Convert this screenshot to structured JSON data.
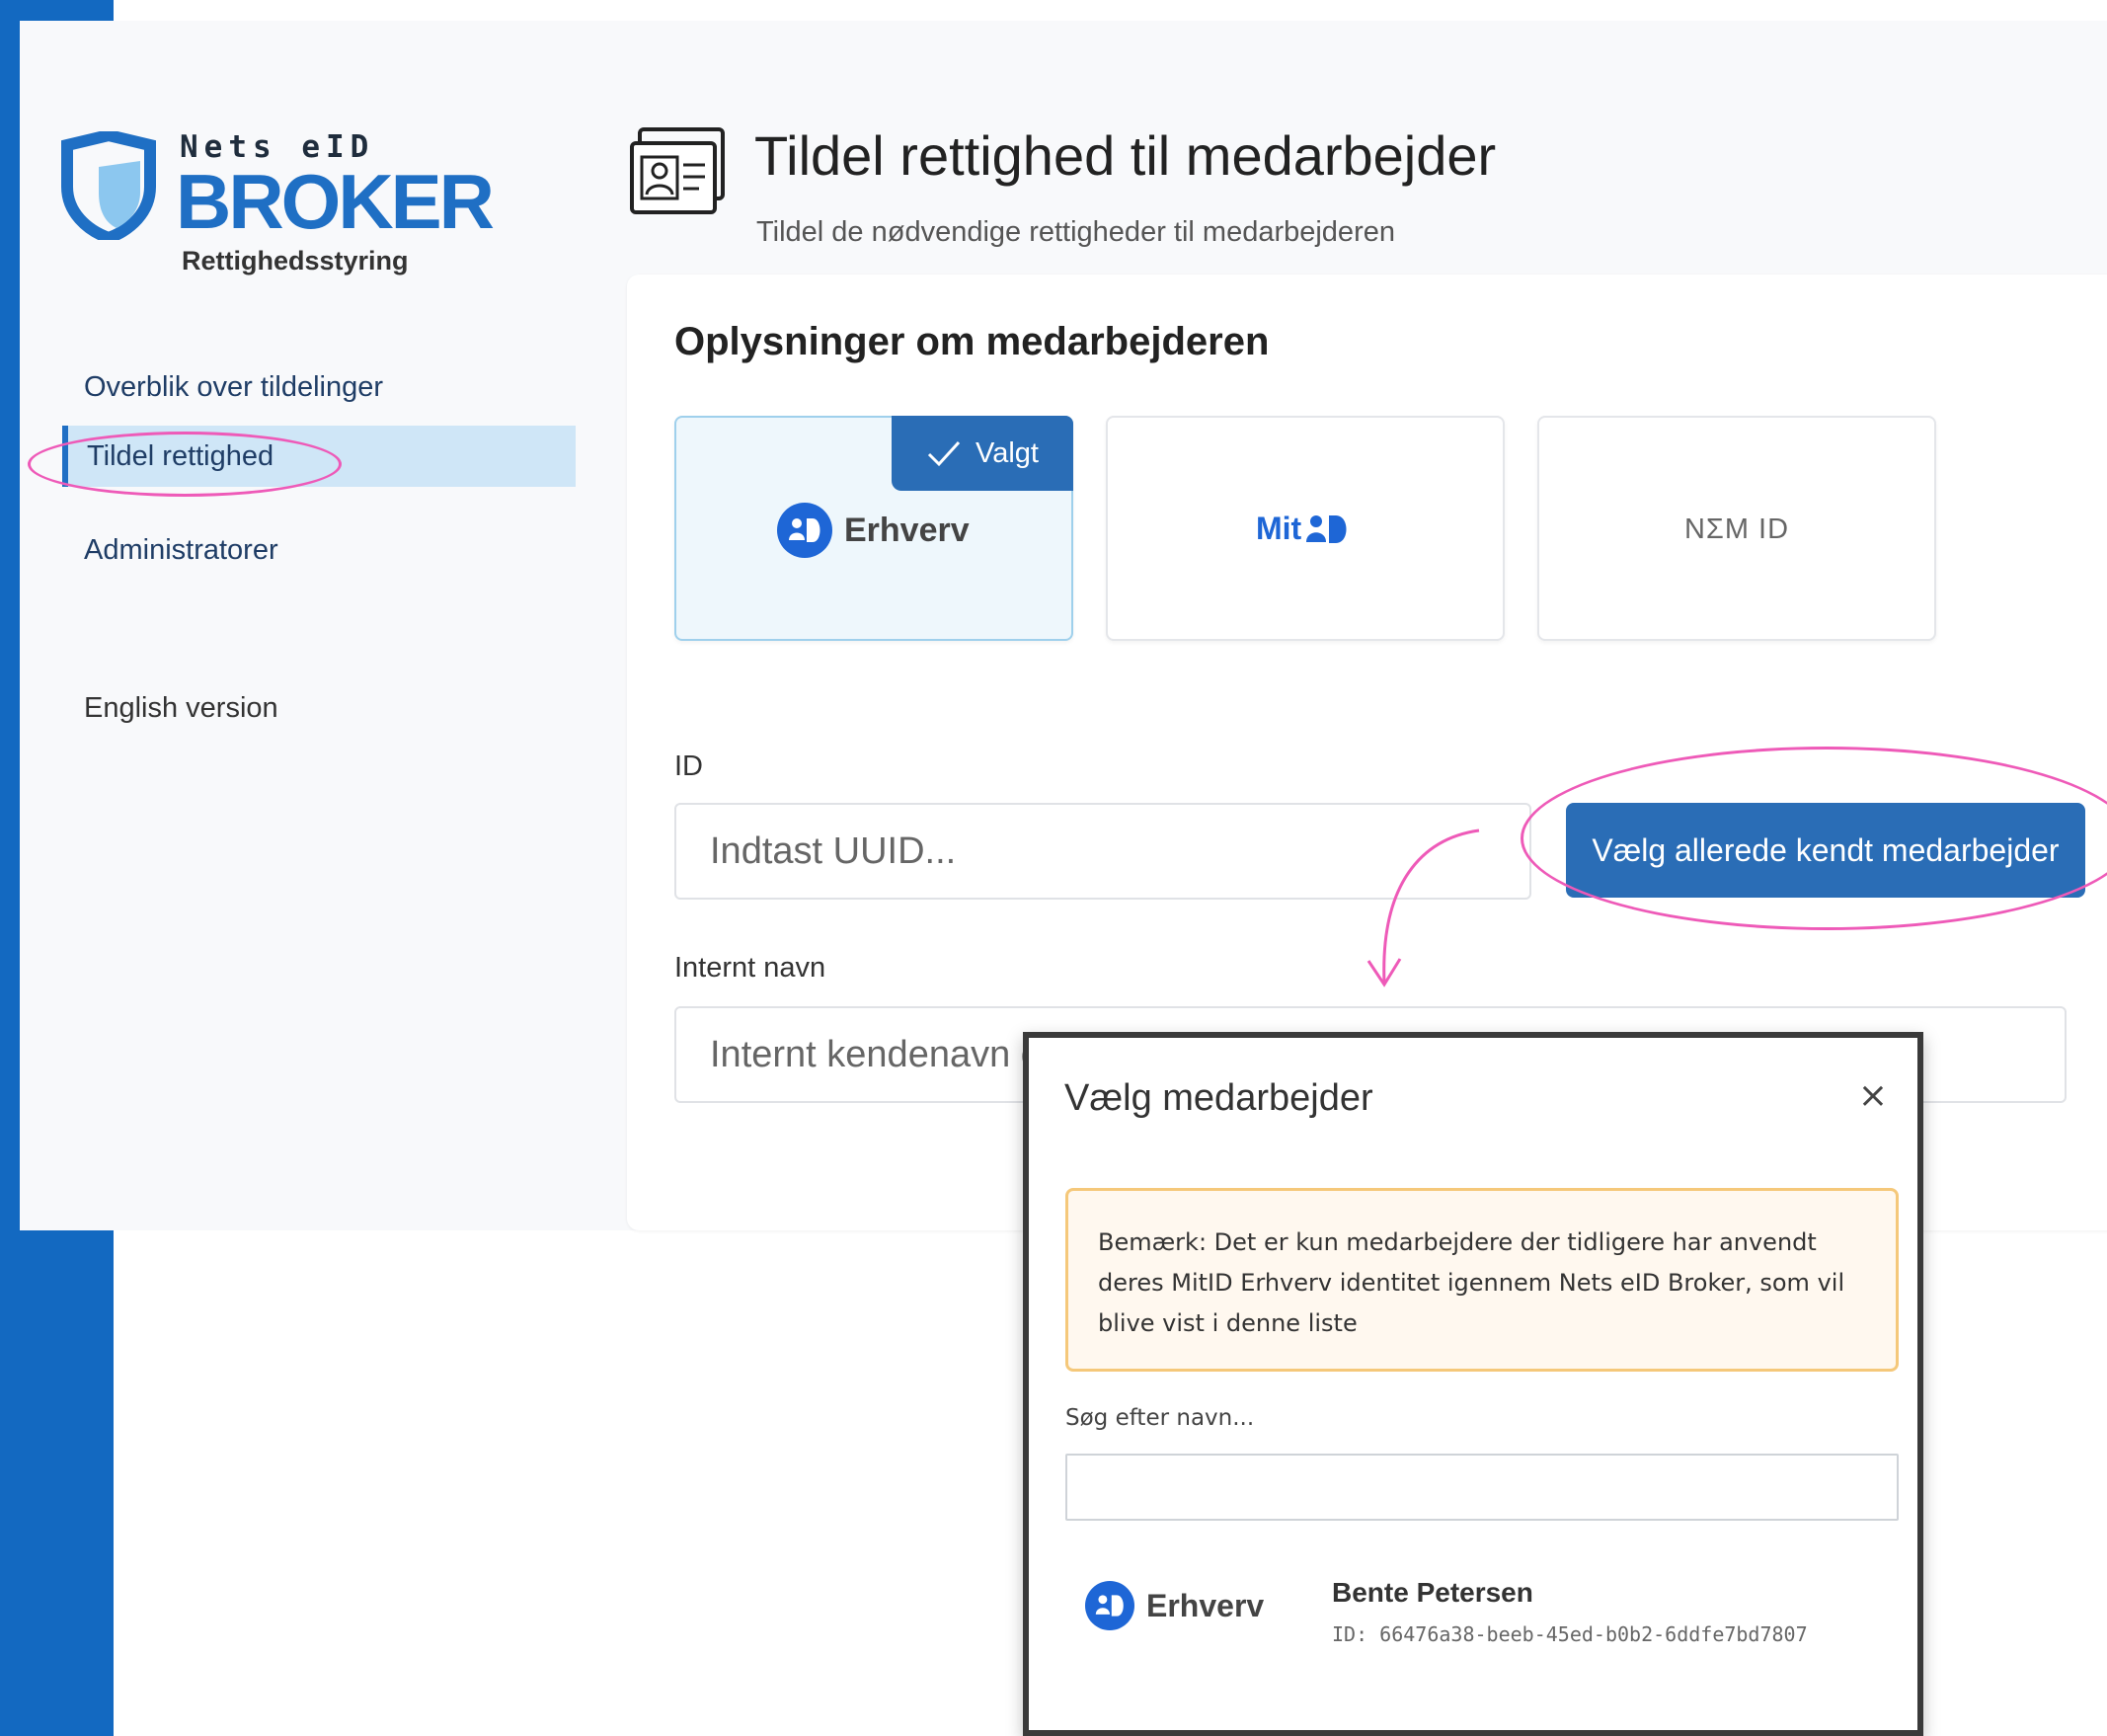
{
  "brand": {
    "nets": "Nets eID",
    "broker": "BROKER",
    "subtitle": "Rettighedsstyring",
    "color": "#1f6fc4"
  },
  "sidebar": {
    "items": [
      {
        "label": "Overblik over tildelinger",
        "active": false
      },
      {
        "label": "Tildel rettighed",
        "active": true
      },
      {
        "label": "Administratorer",
        "active": false
      },
      {
        "label": "English version",
        "active": false
      }
    ]
  },
  "header": {
    "title": "Tildel rettighed til medarbejder",
    "subtitle": "Tildel de nødvendige rettigheder til medarbejderen",
    "icon": "id-card-icon"
  },
  "card": {
    "title": "Oplysninger om medarbejderen",
    "options": [
      {
        "label": "Erhverv",
        "selected": true,
        "badge": "Valgt"
      },
      {
        "label": "Mit",
        "selected": false
      },
      {
        "label": "NΣM ID",
        "selected": false
      }
    ],
    "id_field": {
      "label": "ID",
      "placeholder": "Indtast UUID..."
    },
    "known_button": "Vælg allerede kendt medarbejder",
    "name_field": {
      "label": "Internt navn",
      "placeholder": "Internt kendenavn eller f.eks. medarbejdernummer"
    }
  },
  "modal": {
    "title": "Vælg medarbejder",
    "close": "×",
    "notice": "Bemærk: Det er kun medarbejdere der tidligere har anvendt deres MitID Erhverv identitet igennem Nets eID Broker, som vil blive vist i denne liste",
    "search_label": "Søg efter navn...",
    "search_value": "",
    "results": [
      {
        "provider": "Erhverv",
        "name": "Bente Petersen",
        "id": "ID: 66476a38-beeb-45ed-b0b2-6ddfe7bd7807"
      }
    ]
  },
  "colors": {
    "accent": "#2a6db6",
    "highlight": "#ee5ab8",
    "notice_border": "#f5c87a"
  }
}
